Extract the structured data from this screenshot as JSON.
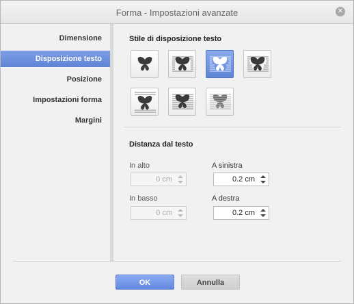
{
  "window": {
    "title": "Forma - Impostazioni avanzate",
    "close_glyph": "✕"
  },
  "sidebar": {
    "items": [
      {
        "label": "Dimensione",
        "active": false
      },
      {
        "label": "Disposizione testo",
        "active": true
      },
      {
        "label": "Posizione",
        "active": false
      },
      {
        "label": "Impostazioni forma",
        "active": false
      },
      {
        "label": "Margini",
        "active": false
      }
    ]
  },
  "wrapping": {
    "section_title": "Stile di disposizione testo",
    "styles": [
      {
        "icon": "wrap-inline-icon",
        "selected": false
      },
      {
        "icon": "wrap-square-icon",
        "selected": false
      },
      {
        "icon": "wrap-tight-icon",
        "selected": true
      },
      {
        "icon": "wrap-through-icon",
        "selected": false
      },
      {
        "icon": "wrap-top-bottom-icon",
        "selected": false
      },
      {
        "icon": "wrap-in-front-icon",
        "selected": false
      },
      {
        "icon": "wrap-behind-icon",
        "selected": false
      }
    ]
  },
  "distance": {
    "section_title": "Distanza dal testo",
    "top": {
      "label": "In alto",
      "value": "0 cm",
      "disabled": true
    },
    "bottom": {
      "label": "In basso",
      "value": "0 cm",
      "disabled": true
    },
    "left": {
      "label": "A sinistra",
      "value": "0.2 cm",
      "disabled": false
    },
    "right": {
      "label": "A destra",
      "value": "0.2 cm",
      "disabled": false
    }
  },
  "footer": {
    "ok_label": "OK",
    "cancel_label": "Annulla"
  },
  "colors": {
    "accent": "#6289e0",
    "active_item": "#5f84d6"
  }
}
